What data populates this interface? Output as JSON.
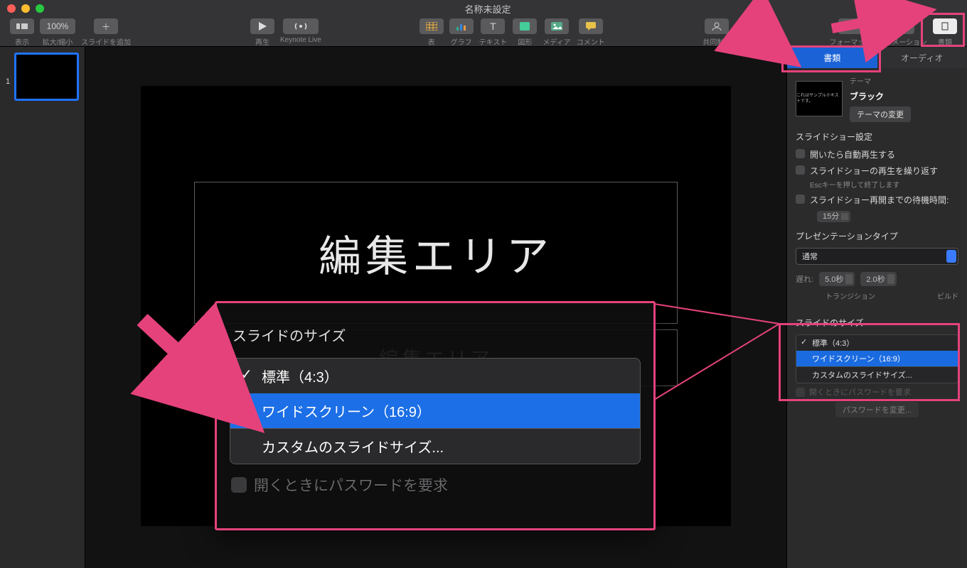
{
  "titlebar": {
    "title": "名称未設定"
  },
  "toolbar": {
    "view": "表示",
    "zoom_value": "100%",
    "zoom": "拡大/縮小",
    "add_slide": "スライドを追加",
    "play": "再生",
    "keynote_live": "Keynote Live",
    "table": "表",
    "chart": "グラフ",
    "text": "テキスト",
    "shape": "図形",
    "media": "メディア",
    "comment": "コメント",
    "collab": "共同制作",
    "format": "フォーマット",
    "animate": "アニメーション",
    "document": "書類"
  },
  "slidenav": {
    "slide1_num": "1"
  },
  "canvas": {
    "title_placeholder": "編集エリア",
    "subtitle_placeholder": "編集エリア"
  },
  "inspector": {
    "tab_document": "書類",
    "tab_audio": "オーディオ",
    "theme_label": "テーマ",
    "theme_name": "ブラック",
    "theme_sample": "これはサンプルテキストです。",
    "change_theme": "テーマの変更",
    "slideshow_settings": "スライドショー設定",
    "auto_play": "開いたら自動再生する",
    "loop": "スライドショーの再生を繰り返す",
    "loop_hint": "Escキーを押して終了します",
    "idle_restart": "スライドショー再開までの待機時間:",
    "idle_value": "15分",
    "presentation_type": "プレゼンテーションタイプ",
    "ptype_value": "通常",
    "delay_label": "遅れ:",
    "transition_delay": "5.0秒",
    "build_delay": "2.0秒",
    "transition": "トランジション",
    "build": "ビルド",
    "slide_size": "スライドのサイズ",
    "size_std": "標準（4:3）",
    "size_wide": "ワイドスクリーン（16:9）",
    "size_custom": "カスタムのスライドサイズ...",
    "require_pw_obscured": "開くときにパスワードを要求",
    "change_pw": "パスワードを変更..."
  },
  "popup": {
    "title": "スライドのサイズ",
    "opt_std": "標準（4:3）",
    "opt_wide": "ワイドスクリーン（16:9）",
    "opt_custom": "カスタムのスライドサイズ...",
    "hidden_below": "開くときにパスワードを要求"
  }
}
